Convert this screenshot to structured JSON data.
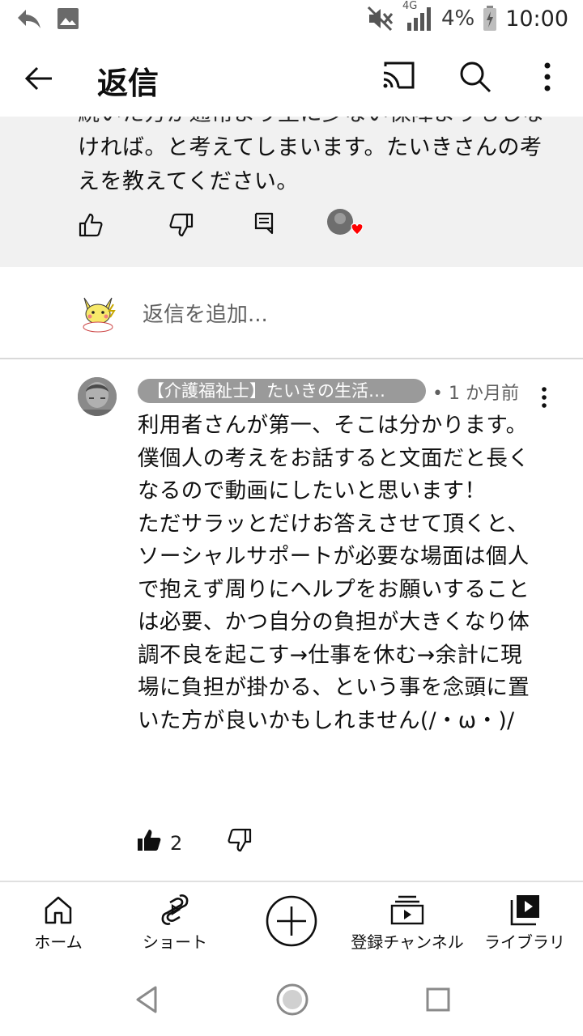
{
  "status_bar": {
    "network": "4G",
    "battery": "4%",
    "time": "10:00"
  },
  "header": {
    "title": "返信"
  },
  "parent_comment": {
    "text_partial": "続いた方が通常より主に少ない保障よりもしな",
    "text": "ければ。と考えてしまいます。たいきさんの考えを教えてください。"
  },
  "add_reply": {
    "placeholder": "返信を追加..."
  },
  "reply": {
    "author": "【介護福祉士】たいきの生活…",
    "time": "• 1 か月前",
    "text": "利用者さんが第一、そこは分かります。\n僕個人の考えをお話すると文面だと長くなるので動画にしたいと思います！\nただサラッとだけお答えさせて頂くと、ソーシャルサポートが必要な場面は個人で抱えず周りにヘルプをお願いすることは必要、かつ自分の負担が大きくなり体調不良を起こす→仕事を休む→余計に現場に負担が掛かる、という事を念頭に置いた方が良いかもしれません(/・ω・)/",
    "likes": "2"
  },
  "bottom_nav": {
    "home": "ホーム",
    "shorts": "ショート",
    "subscriptions": "登録チャンネル",
    "library": "ライブラリ"
  },
  "colors": {
    "heart": "#ff0000",
    "parent_bg": "#f1f1f1",
    "chip_bg": "#9a9a9a"
  }
}
